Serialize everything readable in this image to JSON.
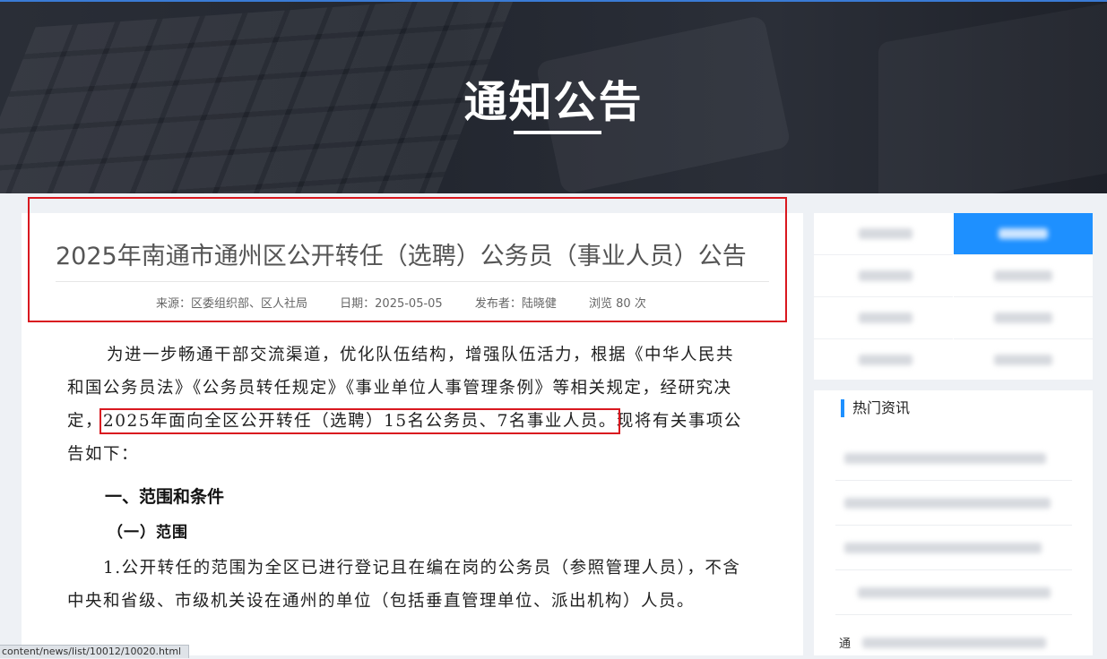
{
  "banner": {
    "title": "通知公告"
  },
  "article": {
    "title": "2025年南通市通州区公开转任（选聘）公务员（事业人员）公告",
    "meta": {
      "source": "来源：区委组织部、区人社局",
      "date": "日期：2025-05-05",
      "publisher": "发布者：陆晓健",
      "views": "浏览 80 次"
    },
    "p1_before": "为进一步畅通干部交流渠道，优化队伍结构，增强队伍活力，根据《中华人民共和国公务员法》《公务员转任规定》《事业单位人事管理条例》等相关规定，经研究决定，",
    "p1_highlight": "2025年面向全区公开转任（选聘）15名公务员、7名事业人员。",
    "p1_after": "现将有关事项公告如下：",
    "section1": "一、范围和条件",
    "subsection1": "（一）范围",
    "p2": "1.公开转任的范围为全区已进行登记且在编在岗的公务员（参照管理人员），不含中央和省级、市级机关设在通州的单位（包括垂直管理单位、派出机构）人员。"
  },
  "status_url": "content/news/list/10012/10020.html",
  "sidebar": {
    "hot_title": "热门资讯",
    "hot_items": [
      {
        "text": ""
      },
      {
        "text": ""
      },
      {
        "text": ""
      },
      {
        "text": ""
      },
      {
        "text": "通"
      }
    ]
  },
  "colors": {
    "accent": "#1e90ff",
    "annotation": "#d9181f",
    "banner": "#262a33"
  }
}
